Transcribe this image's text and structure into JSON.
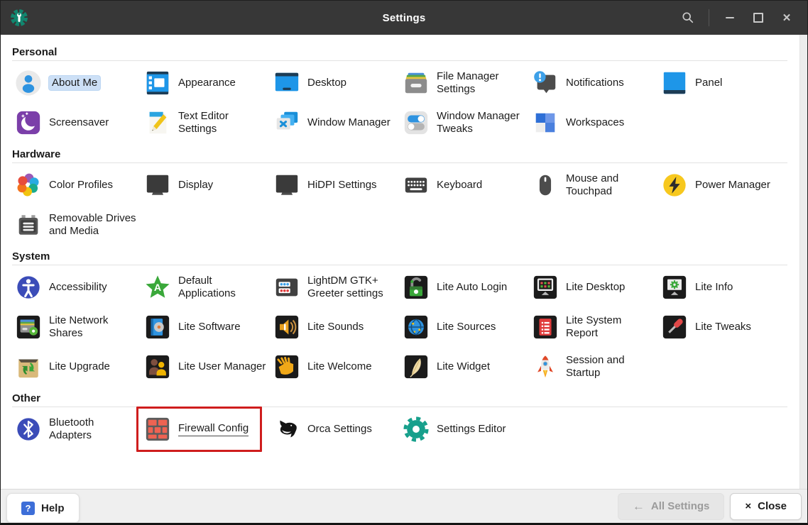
{
  "titlebar": {
    "title": "Settings",
    "app_icon": "settings-manager-icon",
    "controls": [
      "search-icon",
      "minimize-icon",
      "maximize-icon",
      "close-icon"
    ]
  },
  "sections": [
    {
      "title": "Personal",
      "items": [
        {
          "label": "About Me",
          "icon": "about-me",
          "selected": true
        },
        {
          "label": "Appearance",
          "icon": "appearance"
        },
        {
          "label": "Desktop",
          "icon": "desktop"
        },
        {
          "label": "File Manager Settings",
          "icon": "file-manager"
        },
        {
          "label": "Notifications",
          "icon": "notifications"
        },
        {
          "label": "Panel",
          "icon": "panel"
        },
        {
          "label": "Screensaver",
          "icon": "screensaver"
        },
        {
          "label": "Text Editor Settings",
          "icon": "text-editor"
        },
        {
          "label": "Window Manager",
          "icon": "window-manager"
        },
        {
          "label": "Window Manager Tweaks",
          "icon": "wm-tweaks"
        },
        {
          "label": "Workspaces",
          "icon": "workspaces"
        }
      ]
    },
    {
      "title": "Hardware",
      "items": [
        {
          "label": "Color Profiles",
          "icon": "color-profiles"
        },
        {
          "label": "Display",
          "icon": "display"
        },
        {
          "label": "HiDPI Settings",
          "icon": "hidpi"
        },
        {
          "label": "Keyboard",
          "icon": "keyboard"
        },
        {
          "label": "Mouse and Touchpad",
          "icon": "mouse"
        },
        {
          "label": "Power Manager",
          "icon": "power-manager"
        },
        {
          "label": "Removable Drives and Media",
          "icon": "removable-drives"
        }
      ]
    },
    {
      "title": "System",
      "items": [
        {
          "label": "Accessibility",
          "icon": "accessibility"
        },
        {
          "label": "Default Applications",
          "icon": "default-apps"
        },
        {
          "label": "LightDM GTK+ Greeter settings",
          "icon": "lightdm"
        },
        {
          "label": "Lite Auto Login",
          "icon": "lite-auto-login"
        },
        {
          "label": "Lite Desktop",
          "icon": "lite-desktop"
        },
        {
          "label": "Lite Info",
          "icon": "lite-info"
        },
        {
          "label": "Lite Network Shares",
          "icon": "lite-network-shares"
        },
        {
          "label": "Lite Software",
          "icon": "lite-software"
        },
        {
          "label": "Lite Sounds",
          "icon": "lite-sounds"
        },
        {
          "label": "Lite Sources",
          "icon": "lite-sources"
        },
        {
          "label": "Lite System Report",
          "icon": "lite-system-report"
        },
        {
          "label": "Lite Tweaks",
          "icon": "lite-tweaks"
        },
        {
          "label": "Lite Upgrade",
          "icon": "lite-upgrade"
        },
        {
          "label": "Lite User Manager",
          "icon": "lite-user-manager"
        },
        {
          "label": "Lite Welcome",
          "icon": "lite-welcome"
        },
        {
          "label": "Lite Widget",
          "icon": "lite-widget"
        },
        {
          "label": "Session and Startup",
          "icon": "session-startup"
        }
      ]
    },
    {
      "title": "Other",
      "items": [
        {
          "label": "Bluetooth Adapters",
          "icon": "bluetooth"
        },
        {
          "label": "Firewall Config",
          "icon": "firewall",
          "highlighted": true
        },
        {
          "label": "Orca Settings",
          "icon": "orca"
        },
        {
          "label": "Settings Editor",
          "icon": "settings-editor"
        }
      ]
    }
  ],
  "footer": {
    "help": {
      "glyph": "?",
      "label": "Help"
    },
    "all_settings": {
      "glyph": "←",
      "label": "All Settings",
      "disabled": true
    },
    "close": {
      "glyph": "×",
      "label": "Close"
    }
  },
  "colors": {
    "titlebar_bg": "#373737",
    "accent_blue": "#2e93e0",
    "selection_bg": "#cde0f6",
    "highlight_red": "#cf1d1d",
    "footer_bg": "#efefef"
  }
}
